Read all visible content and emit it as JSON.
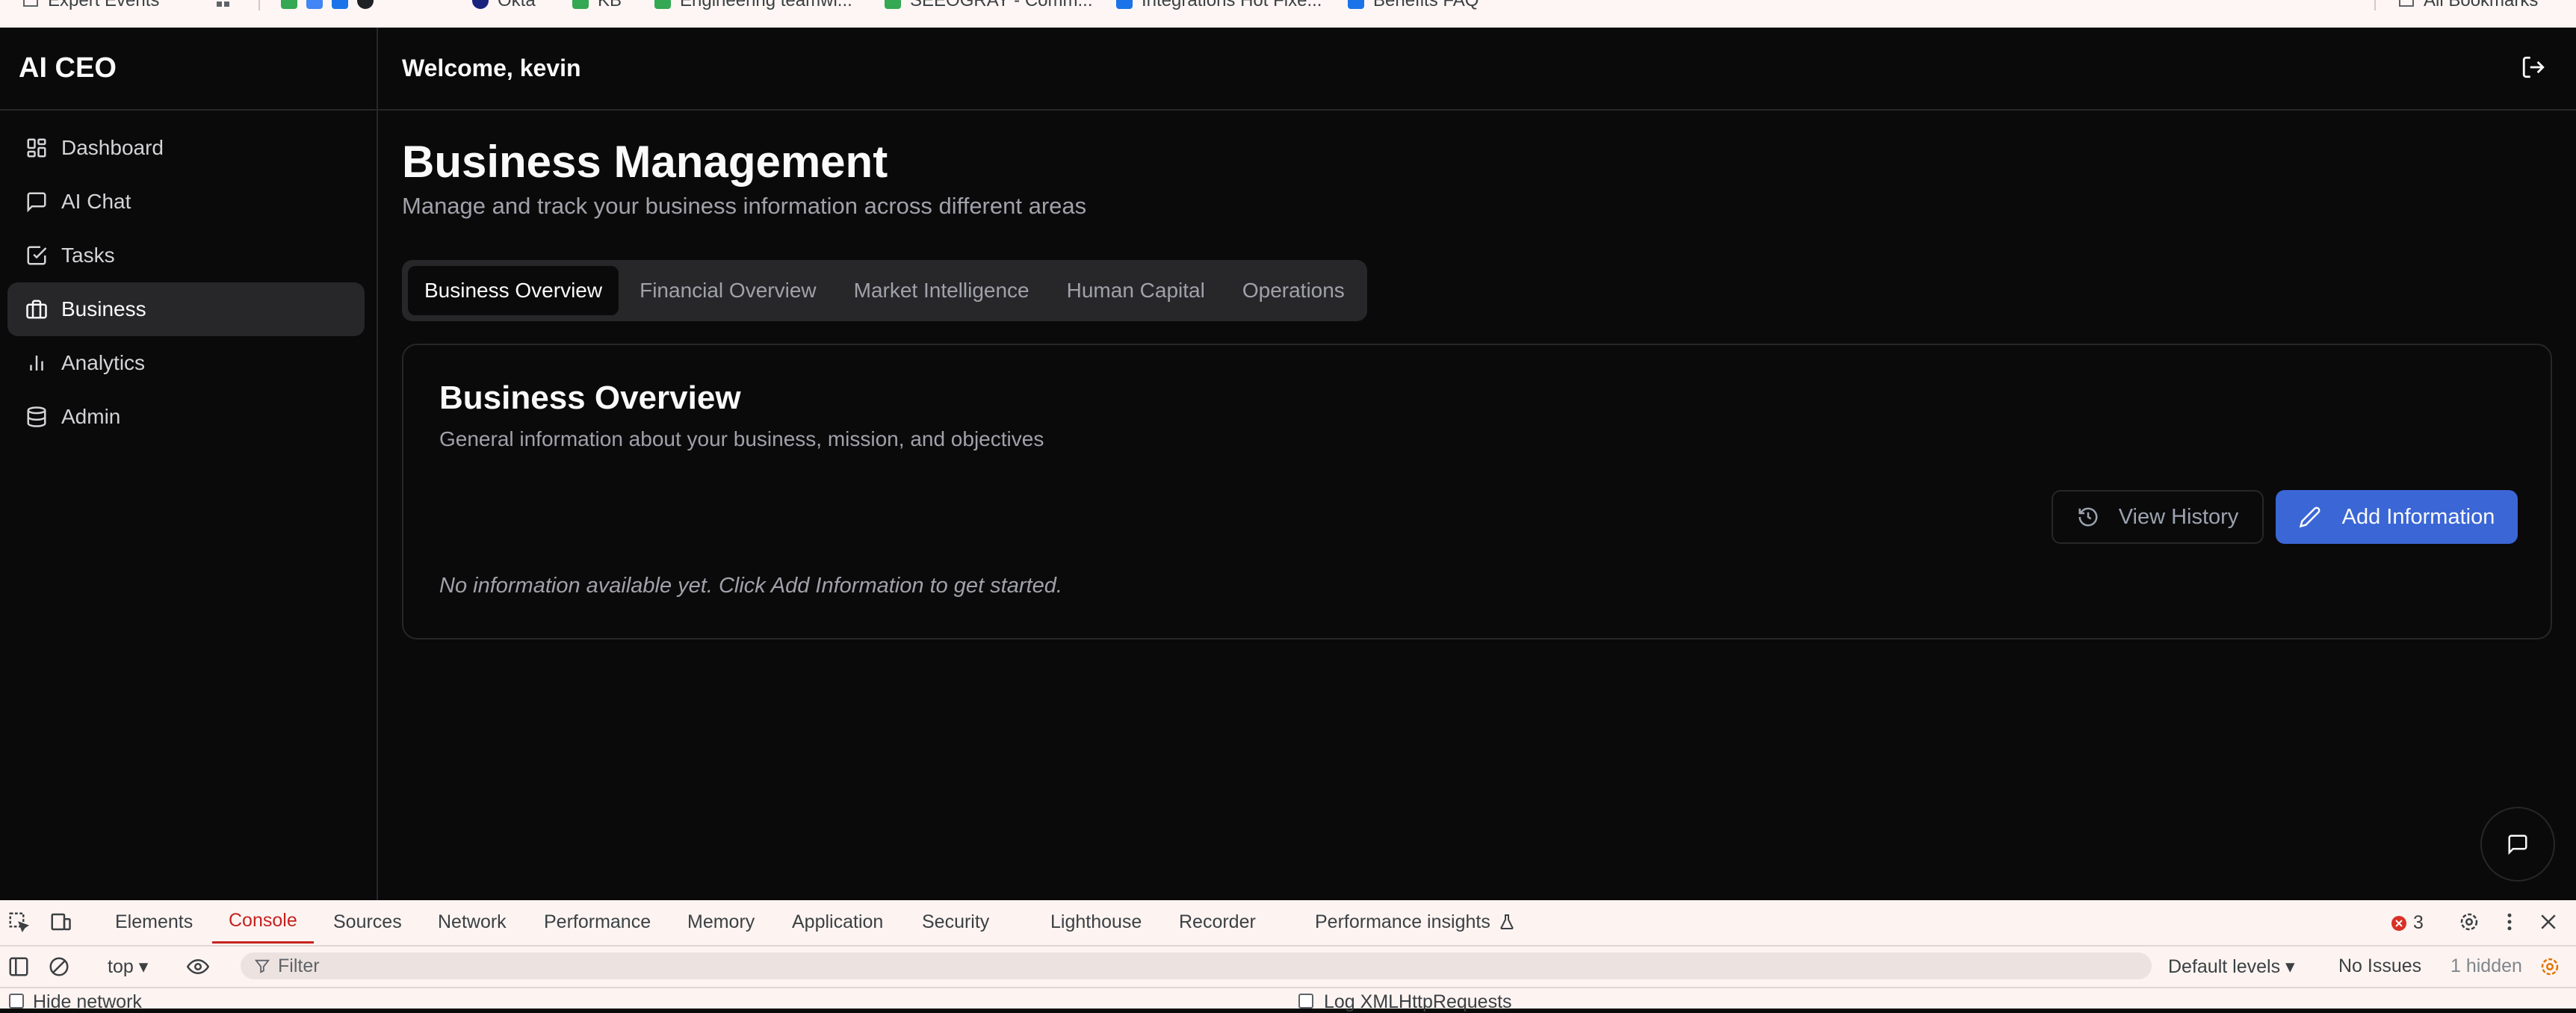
{
  "bookmarks": [
    {
      "label": "Expert Events"
    },
    {
      "label": ""
    },
    {
      "label": "Okta"
    },
    {
      "label": "KB"
    },
    {
      "label": "Engineering teamwi..."
    },
    {
      "label": "SEEOGRAY - Comm..."
    },
    {
      "label": "Integrations Hot Fixe..."
    },
    {
      "label": "Benefits FAQ"
    },
    {
      "label": "All Bookmarks"
    }
  ],
  "sidebar": {
    "brand": "AI CEO",
    "items": [
      {
        "label": "Dashboard",
        "icon": "layout-dashboard-icon"
      },
      {
        "label": "AI Chat",
        "icon": "message-square-icon"
      },
      {
        "label": "Tasks",
        "icon": "check-square-icon"
      },
      {
        "label": "Business",
        "icon": "briefcase-icon",
        "active": true
      },
      {
        "label": "Analytics",
        "icon": "bar-chart-icon"
      },
      {
        "label": "Admin",
        "icon": "database-icon"
      }
    ]
  },
  "header": {
    "welcome": "Welcome, kevin",
    "logout_icon": "log-out-icon"
  },
  "main": {
    "title": "Business Management",
    "subtitle": "Manage and track your business information across different areas",
    "tabs": [
      {
        "label": "Business Overview",
        "active": true
      },
      {
        "label": "Financial Overview"
      },
      {
        "label": "Market Intelligence"
      },
      {
        "label": "Human Capital"
      },
      {
        "label": "Operations"
      }
    ],
    "card": {
      "title": "Business Overview",
      "subtitle": "General information about your business, mission, and objectives",
      "history_button": "View History",
      "add_button": "Add Information",
      "empty_message": "No information available yet. Click Add Information to get started."
    }
  },
  "devtools": {
    "tabs": [
      "Elements",
      "Console",
      "Sources",
      "Network",
      "Performance",
      "Memory",
      "Application",
      "Security",
      "Lighthouse",
      "Recorder",
      "Performance insights"
    ],
    "active_tab": "Console",
    "error_count": "3",
    "context": "top",
    "filter_placeholder": "Filter",
    "levels": "Default levels",
    "issues": "No Issues",
    "hidden": "1 hidden",
    "hide_network": "Hide network",
    "log_xhr": "Log XMLHttpRequests"
  },
  "colors": {
    "background": "#0a0a0b",
    "border": "#27272a",
    "accent": "#3b66d6",
    "devtools_active": "#c5221f"
  }
}
